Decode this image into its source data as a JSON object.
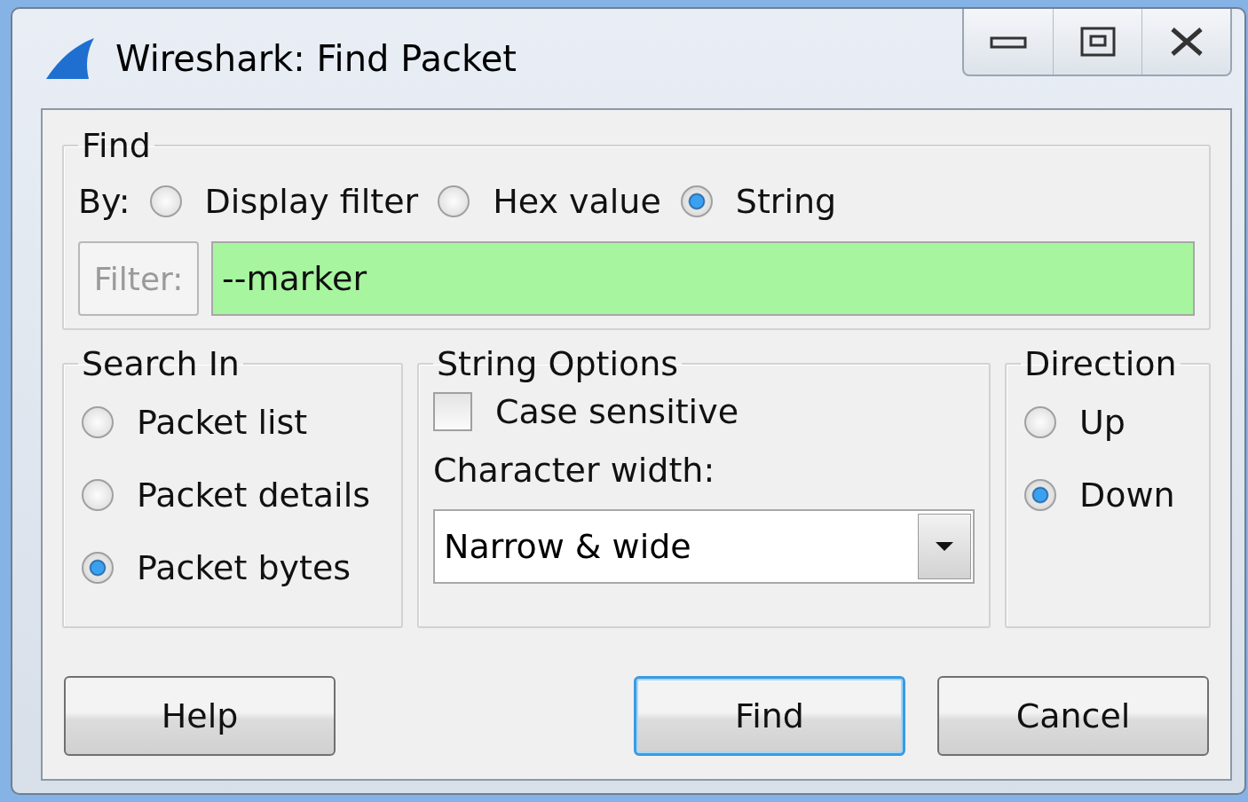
{
  "window": {
    "title": "Wireshark: Find Packet"
  },
  "find": {
    "legend": "Find",
    "by_label": "By:",
    "options": [
      {
        "label": "Display filter",
        "selected": false
      },
      {
        "label": "Hex value",
        "selected": false
      },
      {
        "label": "String",
        "selected": true
      }
    ],
    "filter_button": {
      "label": "Filter:",
      "disabled": true
    },
    "filter_value": "--marker",
    "filter_valid": true
  },
  "search_in": {
    "legend": "Search In",
    "options": [
      {
        "label": "Packet list",
        "selected": false
      },
      {
        "label": "Packet details",
        "selected": false
      },
      {
        "label": "Packet bytes",
        "selected": true
      }
    ]
  },
  "string_options": {
    "legend": "String Options",
    "case_sensitive": {
      "label": "Case sensitive",
      "checked": false
    },
    "character_width_label": "Character width:",
    "character_width": "Narrow & wide"
  },
  "direction": {
    "legend": "Direction",
    "options": [
      {
        "label": "Up",
        "selected": false
      },
      {
        "label": "Down",
        "selected": true
      }
    ]
  },
  "buttons": [
    {
      "label": "Help",
      "default": false
    },
    {
      "label": "Find",
      "default": true
    },
    {
      "label": "Cancel",
      "default": false
    }
  ]
}
